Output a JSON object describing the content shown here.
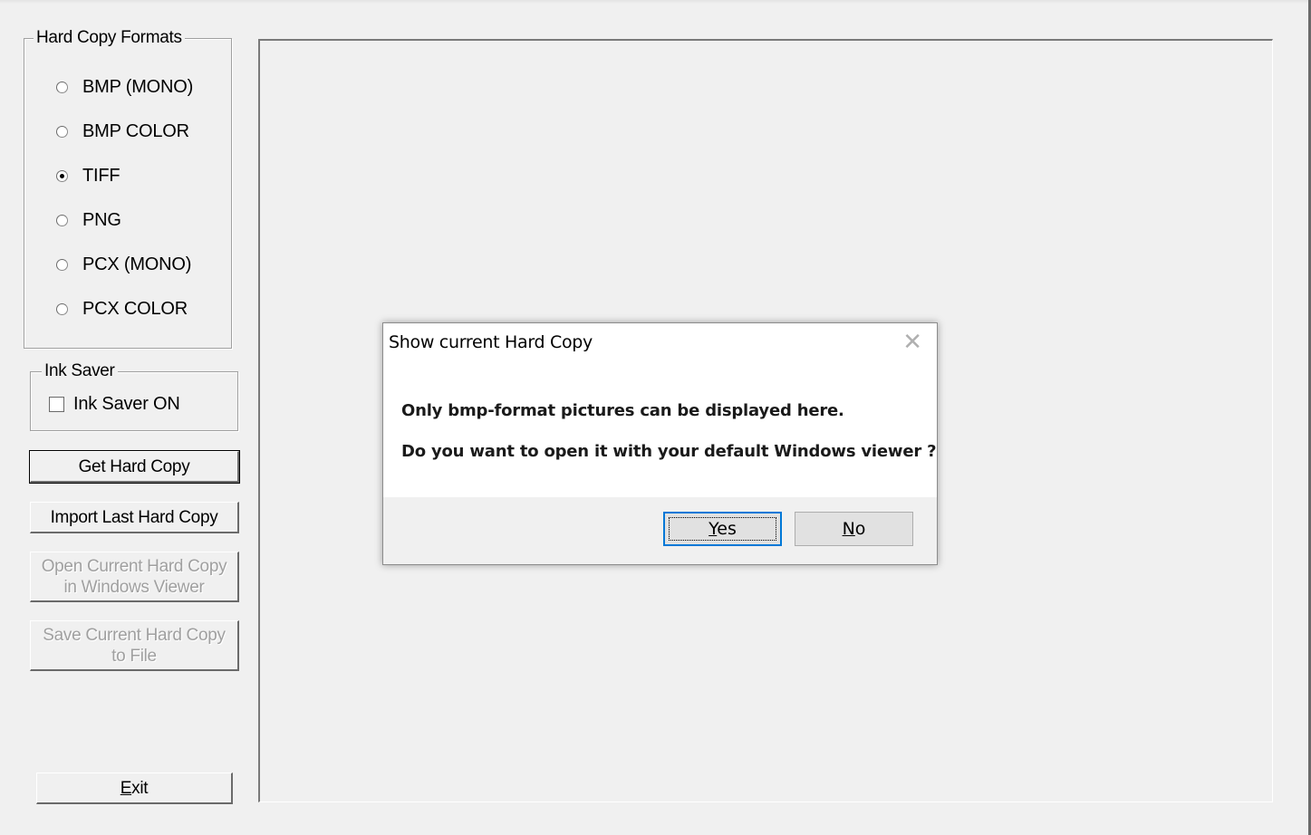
{
  "formats": {
    "title": "Hard Copy Formats",
    "options": [
      {
        "label": "BMP (MONO)",
        "checked": false
      },
      {
        "label": "BMP COLOR",
        "checked": false
      },
      {
        "label": "TIFF",
        "checked": true
      },
      {
        "label": "PNG",
        "checked": false
      },
      {
        "label": "PCX (MONO)",
        "checked": false
      },
      {
        "label": "PCX COLOR",
        "checked": false
      }
    ]
  },
  "ink_saver": {
    "title": "Ink Saver",
    "checkbox_label": "Ink Saver ON",
    "checked": false
  },
  "buttons": {
    "get_hard_copy": "Get Hard Copy",
    "import_last": "Import Last Hard Copy",
    "open_current_line1": "Open Current Hard Copy",
    "open_current_line2": "in Windows Viewer",
    "save_current_line1": "Save Current Hard Copy",
    "save_current_line2": "to File",
    "exit_mnemonic": "E",
    "exit_rest": "xit"
  },
  "dialog": {
    "title": "Show current Hard Copy",
    "close_glyph": "✕",
    "message_line1": "Only bmp-format pictures can be displayed here.",
    "message_line2": "Do you want to open it with your default Windows viewer ?",
    "yes_mnemonic": "Y",
    "yes_rest": "es",
    "no_mnemonic": "N",
    "no_rest": "o"
  },
  "icons": [
    "close-icon",
    "radio-icon",
    "checkbox-icon"
  ]
}
